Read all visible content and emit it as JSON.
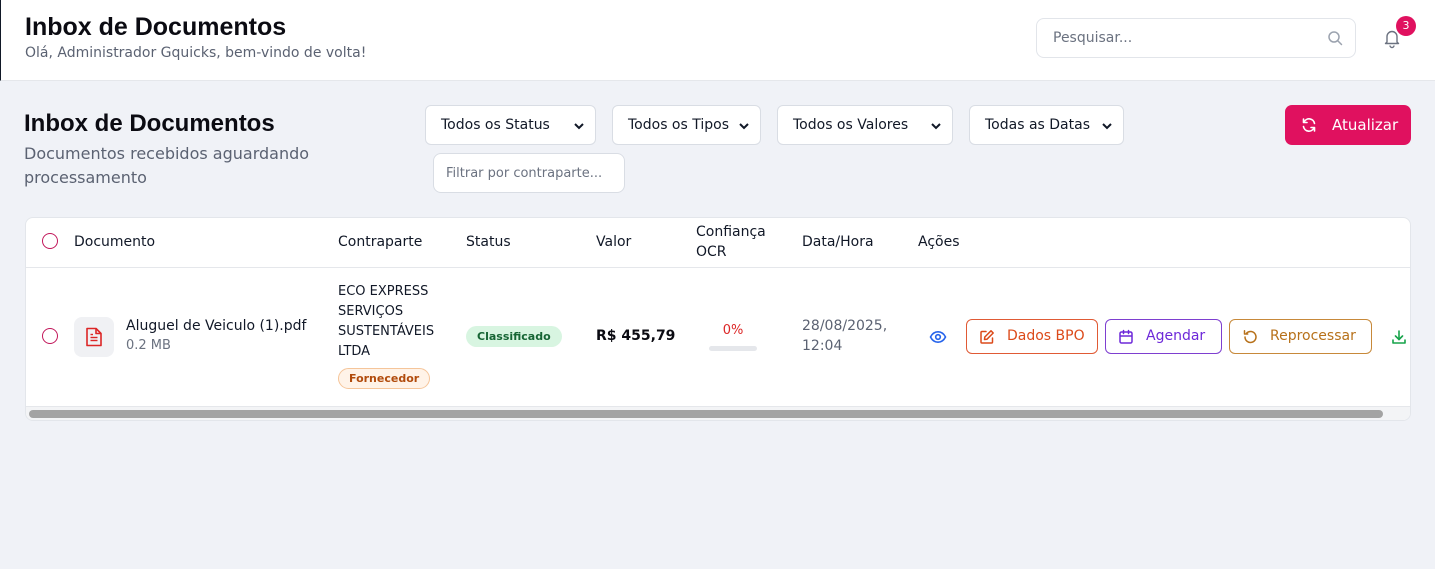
{
  "header": {
    "title": "Inbox de Documentos",
    "welcome": "Olá, Administrador Gquicks, bem-vindo de volta!",
    "search_placeholder": "Pesquisar...",
    "notification_count": "3"
  },
  "section": {
    "title": "Inbox de Documentos",
    "subtitle": "Documentos recebidos aguardando processamento"
  },
  "filters": {
    "status": "Todos os Status",
    "tipos": "Todos os Tipos",
    "valores": "Todos os Valores",
    "datas": "Todas as Datas",
    "counterpart_placeholder": "Filtrar por contraparte..."
  },
  "refresh_label": "Atualizar",
  "table": {
    "columns": {
      "documento": "Documento",
      "contraparte": "Contraparte",
      "status": "Status",
      "valor": "Valor",
      "ocr_line1": "Confiança",
      "ocr_line2": "OCR",
      "datahora": "Data/Hora",
      "acoes": "Ações"
    },
    "rows": [
      {
        "name": "Aluguel de Veiculo (1).pdf",
        "size": "0.2 MB",
        "counterpart_lines": [
          "ECO EXPRESS",
          "SERVIÇOS",
          "SUSTENTÁVEIS",
          "LTDA"
        ],
        "counterpart_type": "Fornecedor",
        "status": "Classificado",
        "valor": "R$ 455,79",
        "ocr_percent": 0,
        "ocr_label": "0%",
        "date_line1": "28/08/2025,",
        "date_line2": "12:04",
        "actions": {
          "dados_bpo": "Dados BPO",
          "agendar": "Agendar",
          "reprocessar": "Reprocessar"
        }
      }
    ]
  },
  "colors": {
    "accent": "#e0115f",
    "status_green_bg": "#d8f5e1",
    "ocr_red": "#dc2626"
  },
  "icons": [
    "search-icon",
    "bell-icon",
    "chevron-down-icon",
    "refresh-icon",
    "pdf-file-icon",
    "eye-icon",
    "edit-icon",
    "calendar-icon",
    "undo-icon",
    "download-icon"
  ]
}
